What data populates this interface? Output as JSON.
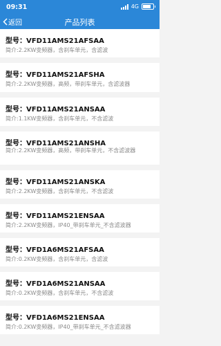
{
  "status_bar": {
    "time": "09:31",
    "network": "4G"
  },
  "navbar": {
    "back_label": "返回",
    "title": "产品列表"
  },
  "products": [
    {
      "model": "型号：VFD11AMS21AFSAA",
      "desc": "简介:2.2KW变频器，含刹车单元，含滤波"
    },
    {
      "model": "型号：VFD11AMS21AFSHA",
      "desc": "简介:2.2KW变频器，高频，带刹车单元，含滤波器"
    },
    {
      "model": "型号：VFD11AMS21ANSAA",
      "desc": "简介:1.1KW变频器，含刹车单元，不含滤波"
    },
    {
      "model": "型号：VFD11AMS21ANSHA",
      "desc": "简介:2.2KW变频器，高频，带刹车单元，不含滤波器"
    },
    {
      "model": "型号：VFD11AMS21ANSKA",
      "desc": "简介:2.2KW变频器，含刹车单元，不含滤波"
    },
    {
      "model": "型号：VFD11AMS21ENSAA",
      "desc": "简介:2.2KW变频器，IP40_带刹车单元_不含滤波器"
    },
    {
      "model": "型号：VFD1A6MS21AFSAA",
      "desc": "简介:0.2KW变频器，含刹车单元，含滤波"
    },
    {
      "model": "型号：VFD1A6MS21ANSAA",
      "desc": "简介:0.2KW变频器，含刹车单元，不含滤波"
    },
    {
      "model": "型号：VFD1A6MS21ENSAA",
      "desc": "简介:0.2KW变频器，IP40_带刹车单元_不含滤波器"
    }
  ],
  "colors": {
    "nav_bg": "#2b87d8",
    "page_bg": "#f3f3f3",
    "desc_text": "#8a8a8a"
  },
  "icons": {
    "back": "chevron-left-icon"
  }
}
